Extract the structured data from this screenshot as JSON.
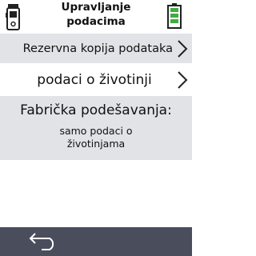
{
  "header": {
    "title_line1": "Upravljanje",
    "title_line2": "podacima",
    "device_icon": "device-reader-icon",
    "battery_icon": "battery-full-icon",
    "battery_color": "#3fae3f"
  },
  "menu": {
    "items": [
      {
        "label": "Rezervna kopija podataka",
        "icon": "chevron-right-icon"
      },
      {
        "label": "podaci o životinji",
        "icon": "chevron-right-icon"
      }
    ]
  },
  "factory_settings": {
    "title": "Fabrička podešavanja:",
    "value": "samo podaci o životinjama"
  },
  "footer": {
    "back_icon": "back-arrow-icon"
  },
  "colors": {
    "row_highlight": "#e1e3e6",
    "footer_bg": "#4a4d5c"
  }
}
